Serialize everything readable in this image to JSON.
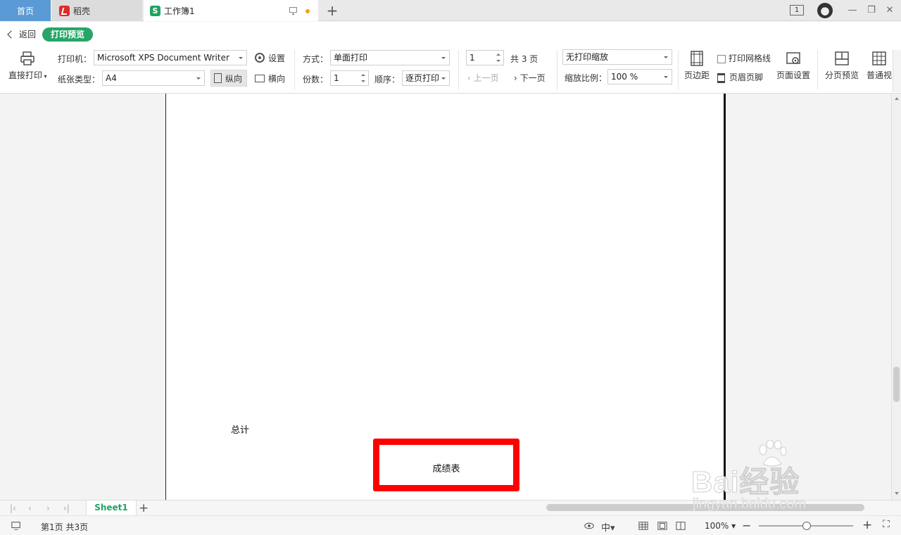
{
  "tabs": {
    "home": "首页",
    "daoke": "稻壳",
    "workbook": "工作簿1"
  },
  "window": {
    "badge": "1",
    "minimize": "—",
    "restore": "❐",
    "close": "✕"
  },
  "toolbar": {
    "back": "返回",
    "preview_label": "打印预览",
    "direct_print": "直接打印",
    "printer_label": "打印机：",
    "printer_value": "Microsoft XPS Document Writer",
    "settings": "设置",
    "paper_label": "纸张类型：",
    "paper_value": "A4",
    "portrait": "纵向",
    "landscape": "横向",
    "mode_label": "方式：",
    "mode_value": "单面打印",
    "copies_label": "份数：",
    "copies_value": "1",
    "order_label": "顺序：",
    "order_value": "逐页打印",
    "page_value": "1",
    "total_pages": "共 3 页",
    "prev_page": "上一页",
    "next_page": "下一页",
    "scale_mode": "无打印缩放",
    "scale_label": "缩放比例：",
    "scale_value": "100 %",
    "margins": "页边距",
    "print_gridlines": "打印网格线",
    "header_footer": "页眉页脚",
    "page_setup": "页面设置",
    "page_break_preview": "分页预览",
    "normal_view": "普通视"
  },
  "page": {
    "total_label": "总计",
    "title_cell": "成绩表"
  },
  "sheets": {
    "active": "Sheet1"
  },
  "status": {
    "page_info": "第1页 共3页",
    "zoom": "100%"
  },
  "watermark": {
    "brand": "Bai经验",
    "url": "jingyan.baidu.com"
  },
  "colors": {
    "accent_green": "#27a567",
    "highlight_red": "#ff0000",
    "home_tab_blue": "#5b9bd5"
  }
}
